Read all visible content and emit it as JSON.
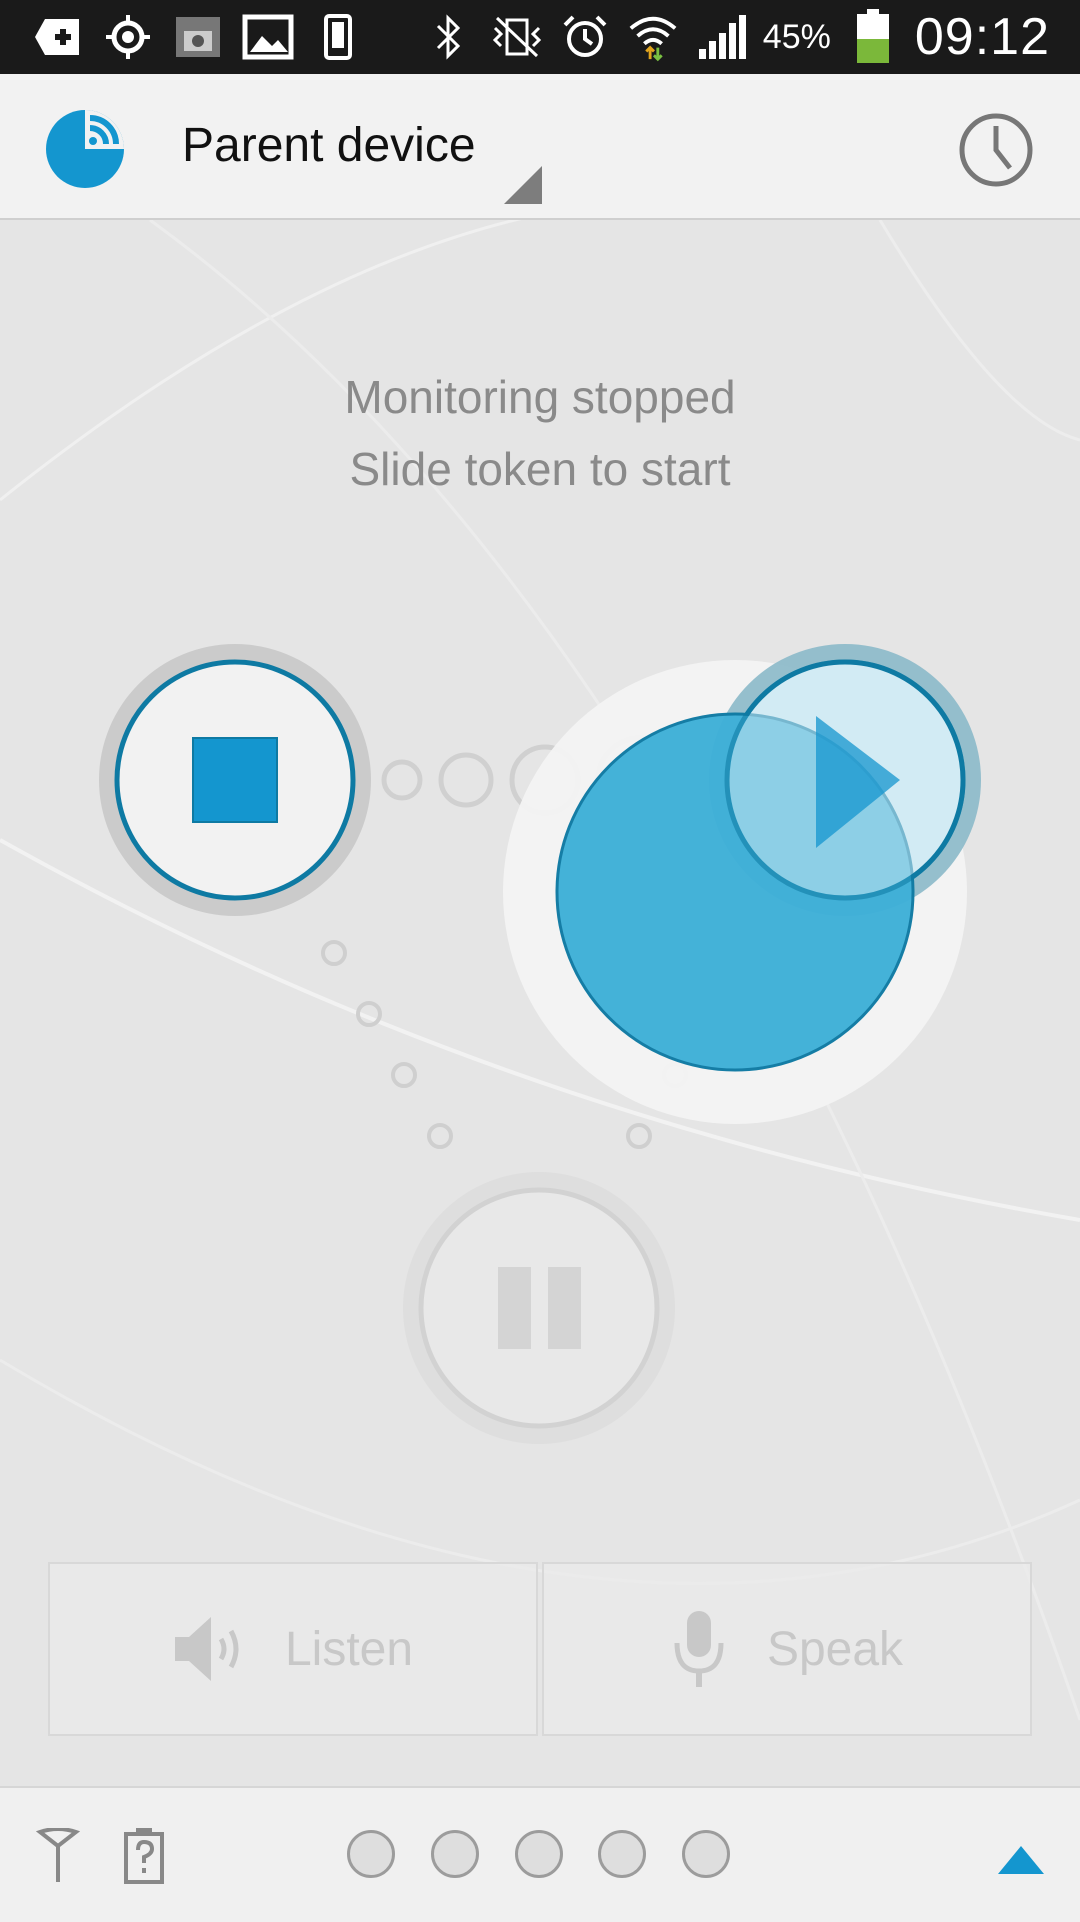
{
  "status_bar": {
    "battery_percent": "45%",
    "time": "09:12",
    "icons": [
      "add-icon",
      "gps-icon",
      "screenshot-icon",
      "gallery-icon",
      "phone-icon",
      "bluetooth-icon",
      "vibrate-icon",
      "alarm-icon",
      "wifi-icon",
      "signal-icon",
      "battery-icon"
    ]
  },
  "app_bar": {
    "title": "Parent device"
  },
  "main": {
    "status_line_1": "Monitoring stopped",
    "status_line_2": "Slide token to start"
  },
  "actions": {
    "listen_label": "Listen",
    "speak_label": "Speak"
  },
  "colors": {
    "accent": "#1496cf",
    "token": "#3fb0d8",
    "ring": "#0e7aa3"
  }
}
